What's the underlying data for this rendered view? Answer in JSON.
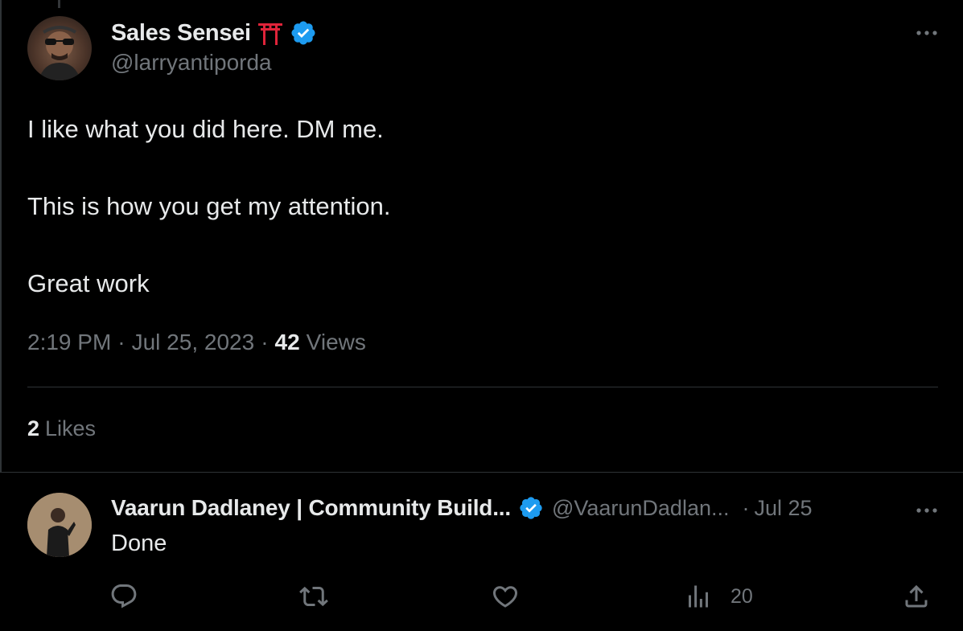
{
  "main_tweet": {
    "display_name": "Sales Sensei",
    "handle": "@larryantiporda",
    "text_lines": [
      "I like what you did here. DM me.",
      "This is how you get my attention.",
      "Great work"
    ],
    "time": "2:19 PM",
    "date": "Jul 25, 2023",
    "views_count": "42",
    "views_label": "Views",
    "likes_count": "2",
    "likes_label": "Likes",
    "separator": "·",
    "icons": {
      "name_emoji": "torii-gate-icon",
      "verified": "verified-badge-icon",
      "more": "more-options-icon"
    }
  },
  "reply": {
    "display_name": "Vaarun Dadlaney | Community Build...",
    "handle": "@VaarunDadlan...",
    "separator": "·",
    "date": "Jul 25",
    "text": "Done",
    "views_count": "20",
    "icons": {
      "reply": "reply-icon",
      "retweet": "retweet-icon",
      "like": "heart-icon",
      "views": "views-icon",
      "share": "share-icon",
      "verified": "verified-badge-icon",
      "more": "more-options-icon"
    }
  },
  "colors": {
    "background": "#000000",
    "text_primary": "#e7e9ea",
    "text_secondary": "#71767b",
    "verified_blue": "#1d9bf0",
    "divider": "#2f3336",
    "torii_red": "#e0243a"
  }
}
